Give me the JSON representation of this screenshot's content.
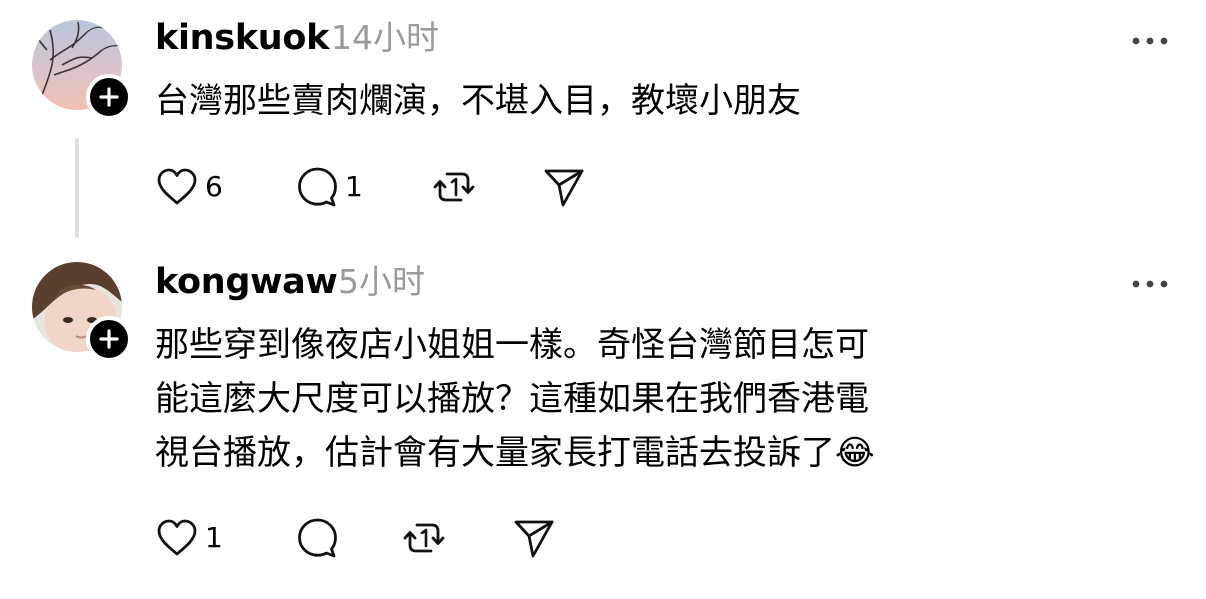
{
  "posts": [
    {
      "username": "kinskuok",
      "time": "14小时",
      "text_lines": [
        "台灣那些賣肉爛演，不堪入目，教壞小朋友"
      ],
      "likes": "6",
      "replies": "1",
      "icons": [
        "avatar",
        "follow-plus-icon",
        "more-icon",
        "heart-icon",
        "comment-icon",
        "repost-icon",
        "share-icon"
      ]
    },
    {
      "username": "kongwaw",
      "time": "5小时",
      "text_lines": [
        "那些穿到像夜店小姐姐一樣。奇怪台灣節目怎可",
        "能這麼大尺度可以播放？這種如果在我們香港電",
        "視台播放，估計會有大量家長打電話去投訴了"
      ],
      "emoji": "😂",
      "likes": "1",
      "replies": "",
      "icons": [
        "avatar",
        "follow-plus-icon",
        "more-icon",
        "heart-icon",
        "comment-icon",
        "repost-icon",
        "share-icon"
      ]
    }
  ]
}
